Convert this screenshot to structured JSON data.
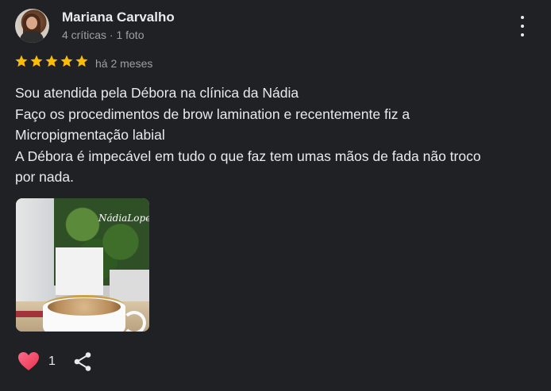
{
  "reviewer": {
    "name": "Mariana Carvalho",
    "meta": "4 críticas · 1 foto"
  },
  "rating": {
    "stars": 5,
    "max": 5,
    "color": "#fbbc04",
    "time": "há 2 meses"
  },
  "review": {
    "lines": [
      "Sou atendida pela Débora na clínica da Nádia",
      "Faço os procedimentos de brow lamination e recentemente fiz a",
      "Micropigmentação labial",
      "A Débora é impecável em tudo o que faz tem umas mãos de fada não troco",
      "por nada."
    ]
  },
  "photo": {
    "sign_text": "NádiaLopes"
  },
  "actions": {
    "like_count": "1",
    "like_icon": "heart-icon",
    "share_icon": "share-icon",
    "menu_icon": "more-vert-icon"
  }
}
